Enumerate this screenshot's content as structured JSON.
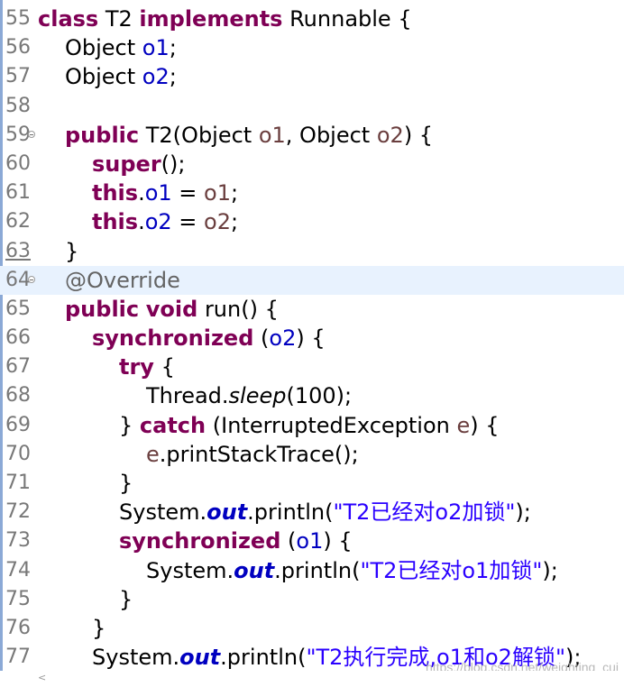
{
  "editor": {
    "lines": [
      {
        "num": "55",
        "tokens": [
          {
            "t": "class",
            "c": "kw"
          },
          {
            "t": " T2 "
          },
          {
            "t": "implements",
            "c": "kw"
          },
          {
            "t": " Runnable {"
          }
        ]
      },
      {
        "num": "56",
        "indent": 1,
        "tokens": [
          {
            "t": "Object "
          },
          {
            "t": "o1",
            "c": "field"
          },
          {
            "t": ";"
          }
        ]
      },
      {
        "num": "57",
        "indent": 1,
        "tokens": [
          {
            "t": "Object "
          },
          {
            "t": "o2",
            "c": "field"
          },
          {
            "t": ";"
          }
        ]
      },
      {
        "num": "58",
        "tokens": []
      },
      {
        "num": "59",
        "fold": true,
        "indent": 1,
        "tokens": [
          {
            "t": "public",
            "c": "kw"
          },
          {
            "t": " T2(Object "
          },
          {
            "t": "o1",
            "c": "param"
          },
          {
            "t": ", Object "
          },
          {
            "t": "o2",
            "c": "param"
          },
          {
            "t": ") {"
          }
        ]
      },
      {
        "num": "60",
        "indent": 2,
        "tokens": [
          {
            "t": "super",
            "c": "kw"
          },
          {
            "t": "();"
          }
        ]
      },
      {
        "num": "61",
        "indent": 2,
        "tokens": [
          {
            "t": "this",
            "c": "kw"
          },
          {
            "t": "."
          },
          {
            "t": "o1",
            "c": "field"
          },
          {
            "t": " = "
          },
          {
            "t": "o1",
            "c": "param"
          },
          {
            "t": ";"
          }
        ]
      },
      {
        "num": "62",
        "indent": 2,
        "tokens": [
          {
            "t": "this",
            "c": "kw"
          },
          {
            "t": "."
          },
          {
            "t": "o2",
            "c": "field"
          },
          {
            "t": " = "
          },
          {
            "t": "o2",
            "c": "param"
          },
          {
            "t": ";"
          }
        ]
      },
      {
        "num": "63",
        "underline": true,
        "indent": 1,
        "tokens": [
          {
            "t": "}"
          }
        ]
      },
      {
        "num": "64",
        "fold": true,
        "current": true,
        "indent": 1,
        "tokens": [
          {
            "t": "@Override",
            "c": "ann"
          }
        ]
      },
      {
        "num": "65",
        "indent": 1,
        "tokens": [
          {
            "t": "public",
            "c": "kw"
          },
          {
            "t": " "
          },
          {
            "t": "void",
            "c": "kw"
          },
          {
            "t": " run() {"
          }
        ]
      },
      {
        "num": "66",
        "indent": 2,
        "tokens": [
          {
            "t": "synchronized",
            "c": "kw"
          },
          {
            "t": " ("
          },
          {
            "t": "o2",
            "c": "field"
          },
          {
            "t": ") {"
          }
        ]
      },
      {
        "num": "67",
        "indent": 3,
        "tokens": [
          {
            "t": "try",
            "c": "kw"
          },
          {
            "t": " {"
          }
        ]
      },
      {
        "num": "68",
        "indent": 4,
        "tokens": [
          {
            "t": "Thread."
          },
          {
            "t": "sleep",
            "c": "static-method"
          },
          {
            "t": "(100);"
          }
        ]
      },
      {
        "num": "69",
        "indent": 3,
        "tokens": [
          {
            "t": "} "
          },
          {
            "t": "catch",
            "c": "kw"
          },
          {
            "t": " (InterruptedException "
          },
          {
            "t": "e",
            "c": "param"
          },
          {
            "t": ") {"
          }
        ]
      },
      {
        "num": "70",
        "indent": 4,
        "tokens": [
          {
            "t": "e",
            "c": "param"
          },
          {
            "t": ".printStackTrace();"
          }
        ]
      },
      {
        "num": "71",
        "indent": 3,
        "tokens": [
          {
            "t": "}"
          }
        ]
      },
      {
        "num": "72",
        "indent": 3,
        "tokens": [
          {
            "t": "System."
          },
          {
            "t": "out",
            "c": "static-field"
          },
          {
            "t": ".println("
          },
          {
            "t": "\"T2已经对o2加锁\"",
            "c": "str"
          },
          {
            "t": ");"
          }
        ]
      },
      {
        "num": "73",
        "indent": 3,
        "tokens": [
          {
            "t": "synchronized",
            "c": "kw"
          },
          {
            "t": " ("
          },
          {
            "t": "o1",
            "c": "field"
          },
          {
            "t": ") {"
          }
        ]
      },
      {
        "num": "74",
        "indent": 4,
        "tokens": [
          {
            "t": "System."
          },
          {
            "t": "out",
            "c": "static-field"
          },
          {
            "t": ".println("
          },
          {
            "t": "\"T2已经对o1加锁\"",
            "c": "str"
          },
          {
            "t": ");"
          }
        ]
      },
      {
        "num": "75",
        "indent": 3,
        "tokens": [
          {
            "t": "}"
          }
        ]
      },
      {
        "num": "76",
        "indent": 2,
        "tokens": [
          {
            "t": "}"
          }
        ]
      },
      {
        "num": "77",
        "indent": 2,
        "tokens": [
          {
            "t": "System."
          },
          {
            "t": "out",
            "c": "static-field"
          },
          {
            "t": ".println("
          },
          {
            "t": "\"T2执行完成,o1和o2解锁\"",
            "c": "str"
          },
          {
            "t": ");"
          }
        ]
      }
    ]
  },
  "colors": {
    "keyword": "#7f0055",
    "field": "#0000c0",
    "parameter": "#6a3e3e",
    "string": "#2a00ff",
    "annotation": "#646464",
    "current_line": "#e8f2fe",
    "line_number": "#787878"
  },
  "watermark": "https://blog.csdn.net/weighting_cui",
  "scrollbar": {
    "left_arrow": "<"
  }
}
